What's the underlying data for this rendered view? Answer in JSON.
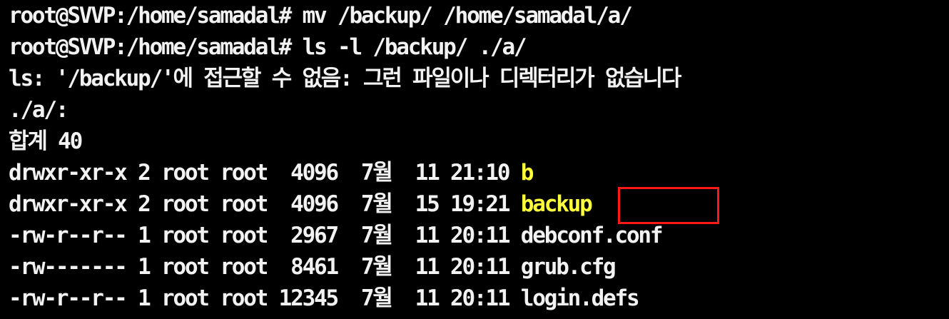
{
  "terminal": {
    "prompt1": "root@SVVP:/home/samadal# mv /backup/ /home/samadal/a/",
    "prompt2": "root@SVVP:/home/samadal# ls -l /backup/ ./a/",
    "error": "ls: '/backup/'에 접근할 수 없음: 그런 파일이나 디렉터리가 없습니다",
    "dir_header": "./a/:",
    "total": "합계 40",
    "rows": [
      {
        "meta": "drwxr-xr-x 2 root root  4096  7월  11 21:10 ",
        "name": "b"
      },
      {
        "meta": "drwxr-xr-x 2 root root  4096  7월  15 19:21 ",
        "name": "backup"
      },
      {
        "meta": "-rw-r--r-- 1 root root  2967  7월  11 20:11 ",
        "name": "debconf.conf"
      },
      {
        "meta": "-rw------- 1 root root  8461  7월  11 20:11 ",
        "name": "grub.cfg"
      },
      {
        "meta": "-rw-r--r-- 1 root root 12345  7월  11 20:11 ",
        "name": "login.defs"
      }
    ]
  },
  "colors": {
    "background": "#000000",
    "text": "#f2f2f2",
    "directory": "#ffff3c",
    "highlight_border": "#ff1a1a"
  }
}
